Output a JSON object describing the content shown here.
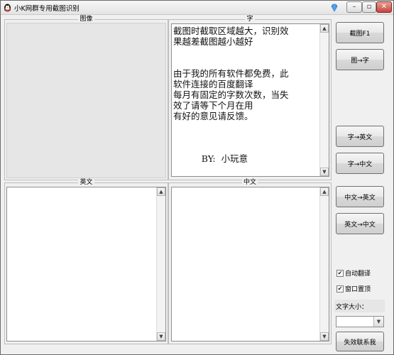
{
  "window": {
    "title": "小K网群专用截图识别",
    "controls": {
      "minimize": "–",
      "restore": "▫",
      "close": "✕"
    }
  },
  "panels": {
    "image_label": "图像",
    "text_label": "字",
    "english_label": "英文",
    "chinese_label": "中文"
  },
  "text_panel": {
    "content": "截图时截取区域越大，识别效\n果越差截图越小越好\n\n\n由于我的所有软件都免费，此\n软件连接的百度翻译\n每月有固定的字数次数，当失\n效了请等下个月在用\n有好的意见请反馈。\n\n\n\n          BY:  小玩意"
  },
  "english_panel": {
    "content": ""
  },
  "chinese_panel": {
    "content": ""
  },
  "buttons": {
    "screenshot": "截图F1",
    "image_to_text": "图→字",
    "text_to_english": "字→英文",
    "text_to_chinese": "字→中文",
    "chinese_to_english": "中文→英文",
    "english_to_chinese": "英文→中文",
    "contact": "失效联系我"
  },
  "options": {
    "auto_translate": {
      "label": "自动翻译",
      "checked": true
    },
    "always_on_top": {
      "label": "窗口置顶",
      "checked": true
    },
    "font_size_label": "文字大小：",
    "font_size_value": ""
  },
  "icons": {
    "app": "qq-penguin-icon",
    "gem": "blue-gem-icon",
    "scroll_up": "▲",
    "scroll_down": "▼",
    "check": "✔"
  }
}
